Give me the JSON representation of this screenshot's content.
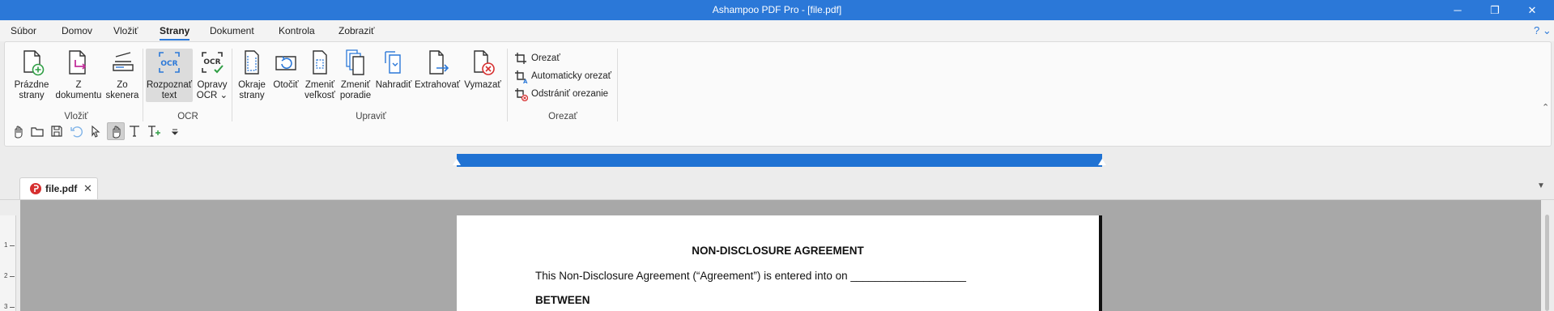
{
  "window": {
    "title": "Ashampoo PDF Pro - [file.pdf]",
    "minimize": "─",
    "maximize": "❐",
    "close": "✕"
  },
  "menu": {
    "tabs": [
      "Súbor",
      "Domov",
      "Vložiť",
      "Strany",
      "Dokument",
      "Kontrola",
      "Zobraziť"
    ],
    "active": "Strany",
    "help": "? ⌄"
  },
  "ribbon": {
    "vlozit": {
      "label": "Vložiť",
      "prazdne": [
        "Prázdne",
        "strany"
      ],
      "z_dokumentu": [
        "Z",
        "dokumentu"
      ],
      "zo_skenera": [
        "Zo",
        "skenera"
      ]
    },
    "ocr": {
      "label": "OCR",
      "rozpoznat": [
        "Rozpoznať",
        "text"
      ],
      "opravy": [
        "Opravy",
        "OCR ⌄"
      ]
    },
    "upravit": {
      "label": "Upraviť",
      "okraje": [
        "Okraje",
        "strany"
      ],
      "otocit": [
        "Otočiť",
        ""
      ],
      "zmenit_velkost": [
        "Zmeniť",
        "veľkosť"
      ],
      "zmenit_poradie": [
        "Zmeniť",
        "poradie"
      ],
      "nahradit": [
        "Nahradiť",
        ""
      ],
      "extrahovat": [
        "Extrahovať",
        ""
      ],
      "vymazat": [
        "Vymazať",
        ""
      ]
    },
    "orezat": {
      "label": "Orezať",
      "orezat": "Orezať",
      "automaticky": "Automaticky orezať",
      "odstranit": "Odstrániť orezanie"
    },
    "collapse": "⌃"
  },
  "doc_tabs": {
    "file": "file.pdf",
    "close": "✕",
    "dropdown": "▼"
  },
  "document": {
    "title": "NON-DISCLOSURE AGREEMENT",
    "line1": "This Non-Disclosure Agreement (“Agreement”) is entered into on ___________________",
    "between": "BETWEEN"
  },
  "vertical_ruler": [
    "1",
    "2",
    "3"
  ],
  "colors": {
    "accent": "#2b78d8",
    "ruler": "#1f72d3",
    "canvas": "#a8a8a8"
  }
}
